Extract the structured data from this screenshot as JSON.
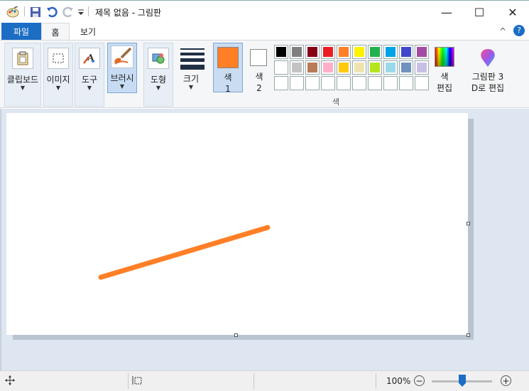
{
  "window": {
    "title": "제목 없음 - 그림판",
    "minimize": "—",
    "maximize": "☐",
    "close": "✕"
  },
  "quick_access": [
    "paint-app-icon",
    "save-icon",
    "undo-icon",
    "redo-icon",
    "customize-dropdown-icon"
  ],
  "tabs": {
    "file": "파일",
    "home": "홈",
    "view": "보기"
  },
  "ribbon": {
    "clipboard": "클립보드",
    "image": "이미지",
    "tools": "도구",
    "brush": "브러시",
    "shapes": "도형",
    "size": "크기",
    "color1_line1": "색",
    "color1_line2": "1",
    "color2_line1": "색",
    "color2_line2": "2",
    "colors_group": "색",
    "edit_colors_line1": "색",
    "edit_colors_line2": "편집",
    "paint3d_line1": "그림판 3",
    "paint3d_line2": "D로 편집"
  },
  "colors": {
    "color1": "#ff7f27",
    "color2": "#ffffff",
    "palette_row1": [
      "#000000",
      "#7f7f7f",
      "#880015",
      "#ed1c24",
      "#ff7f27",
      "#fff200",
      "#22b14c",
      "#00a2e8",
      "#3f48cc",
      "#a349a4"
    ],
    "palette_row2": [
      "#ffffff",
      "#c3c3c3",
      "#b97a57",
      "#ffaec9",
      "#ffc90e",
      "#efe4b0",
      "#b5e61d",
      "#99d9ea",
      "#7092be",
      "#c8bfe7"
    ],
    "palette_row3": [
      "#ffffff",
      "#ffffff",
      "#ffffff",
      "#ffffff",
      "#ffffff",
      "#ffffff",
      "#ffffff",
      "#ffffff",
      "#ffffff",
      "#ffffff"
    ],
    "stroke": "#ff7f27"
  },
  "status": {
    "zoom": "100%",
    "zoom_out": "−",
    "zoom_in": "+",
    "zoom_level_fraction": 0.5
  }
}
